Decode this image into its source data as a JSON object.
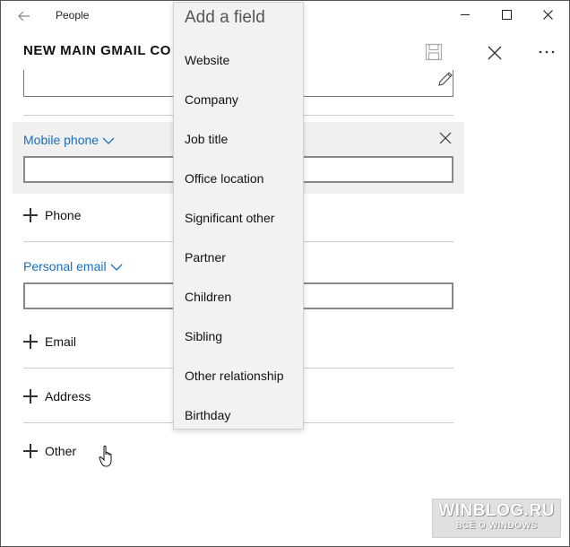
{
  "titlebar": {
    "app_name": "People",
    "back_icon": "back-arrow-icon",
    "minimize_icon": "minimize-icon",
    "maximize_icon": "maximize-icon",
    "close_icon": "close-icon"
  },
  "header": {
    "title": "NEW MAIN GMAIL CO",
    "save_icon": "save-icon",
    "close_icon": "close-icon",
    "more_icon": "more-icon"
  },
  "form": {
    "mobile_phone_label": "Mobile phone",
    "mobile_phone_value": "",
    "phone_add_label": "Phone",
    "personal_email_label": "Personal email",
    "personal_email_value": "",
    "email_add_label": "Email",
    "address_add_label": "Address",
    "other_add_label": "Other",
    "accent_color": "#1a6fb5"
  },
  "dropdown": {
    "title": "Add a field",
    "items": [
      {
        "label": "Website"
      },
      {
        "label": "Company"
      },
      {
        "label": "Job title"
      },
      {
        "label": "Office location"
      },
      {
        "label": "Significant other"
      },
      {
        "label": "Partner"
      },
      {
        "label": "Children"
      },
      {
        "label": "Sibling"
      },
      {
        "label": "Other relationship"
      },
      {
        "label": "Birthday"
      }
    ]
  },
  "watermark": {
    "title": "WINBLOG.RU",
    "subtitle": "ВСЁ О WINDOWS"
  }
}
